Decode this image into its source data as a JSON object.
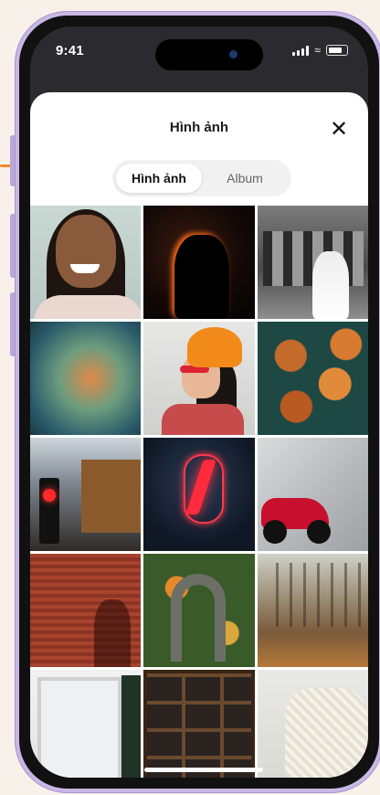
{
  "status_bar": {
    "time": "9:41"
  },
  "sheet": {
    "title": "Hình ảnh",
    "close_icon": "✕",
    "segments": [
      {
        "label": "Hình ảnh",
        "active": true
      },
      {
        "label": "Album",
        "active": false
      }
    ]
  },
  "photos": [
    {
      "icon": "photo-smiling-woman"
    },
    {
      "icon": "photo-dark-silhouette"
    },
    {
      "icon": "photo-bride-in-hall"
    },
    {
      "icon": "photo-bokeh-glass"
    },
    {
      "icon": "photo-orange-beanie-girl"
    },
    {
      "icon": "photo-autumn-leaves"
    },
    {
      "icon": "photo-traffic-light"
    },
    {
      "icon": "photo-neon-lightning"
    },
    {
      "icon": "photo-red-motorcycle"
    },
    {
      "icon": "photo-red-brick-wall"
    },
    {
      "icon": "photo-aerial-road"
    },
    {
      "icon": "photo-autumn-forest"
    },
    {
      "icon": "photo-window-door"
    },
    {
      "icon": "photo-wooden-shelves"
    },
    {
      "icon": "photo-knit-chair"
    }
  ],
  "colors": {
    "frame": "#c9b8e6",
    "accent": "#f08a2a",
    "sheet_bg": "#ffffff",
    "segment_bg": "#f1f1f2"
  }
}
